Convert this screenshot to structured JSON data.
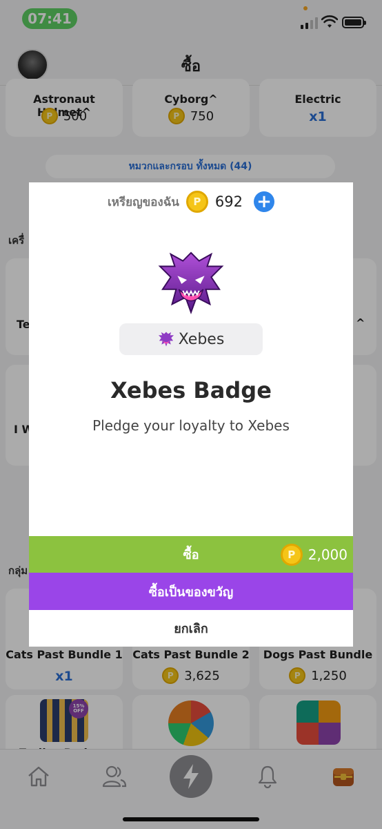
{
  "status_bar": {
    "time": "07:41",
    "accent": "#5fcf65"
  },
  "header": {
    "title": "ซื้อ"
  },
  "store": {
    "top_cards": [
      {
        "title": "Astronaut Helmet^",
        "price": "500"
      },
      {
        "title": "Cyborg^",
        "price": "750"
      },
      {
        "title": "Electric",
        "count": "x1"
      }
    ],
    "category_link": "หมวกและกรอบ ทั้งหมด (44)",
    "section_partial_1": "เครื่",
    "section_partial_2": "กลุ่ม",
    "partial_left_1": "Te",
    "partial_left_2": "I W",
    "partial_right_1": "^",
    "bundles": [
      {
        "title": "Cats Past Bundle 1",
        "count": "x1"
      },
      {
        "title": "Cats Past Bundle 2",
        "price": "3,625"
      },
      {
        "title": "Dogs Past Bundle",
        "price": "1,250"
      }
    ],
    "bottom_cards": [
      {
        "title": "Zodiac Badges",
        "sale_tag": "15% OFF"
      },
      {
        "title": ""
      },
      {
        "title": ""
      }
    ],
    "coin_glyph": "P"
  },
  "modal": {
    "balance_label": "เหรียญของฉัน",
    "balance_value": "692",
    "plus_glyph": "+",
    "badge_name": "Xebes",
    "title": "Xebes Badge",
    "description": "Pledge your loyalty to Xebes",
    "buy_label": "ซื้อ",
    "buy_price": "2,000",
    "gift_label": "ซื้อเป็นของขวัญ",
    "cancel_label": "ยกเลิก",
    "colors": {
      "buy": "#8cc23f",
      "gift": "#9a45e8",
      "plus": "#2f86eb",
      "coin": "#f5c518"
    }
  },
  "tab_bar": {
    "tabs": [
      "home-icon",
      "friends-icon",
      "lightning-icon",
      "bell-icon",
      "treasure-chest-icon"
    ]
  }
}
